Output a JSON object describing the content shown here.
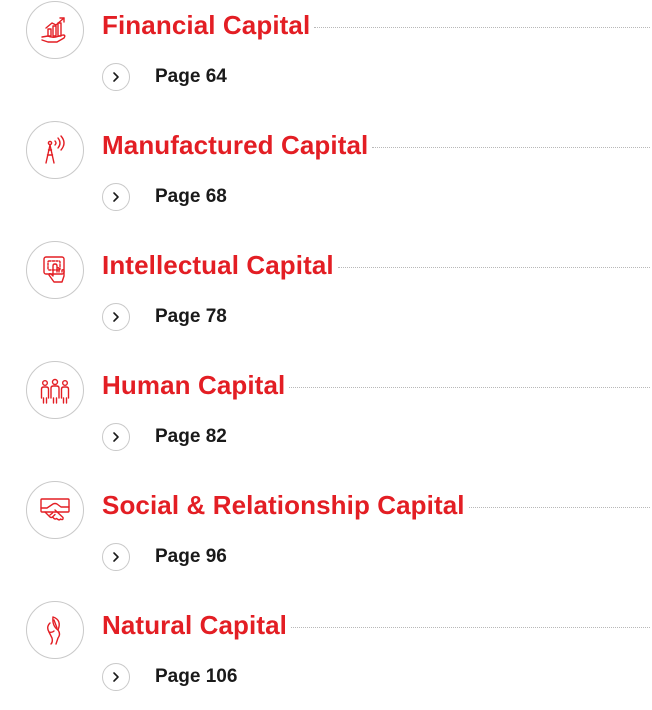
{
  "colors": {
    "accent": "#e31e24",
    "text": "#1a1a1a",
    "ring": "#c9c9c9"
  },
  "capitals": [
    {
      "title": "Financial Capital",
      "page": "Page 64",
      "icon": "financial-growth-icon"
    },
    {
      "title": "Manufactured Capital",
      "page": "Page 68",
      "icon": "transmission-tower-icon"
    },
    {
      "title": "Intellectual Capital",
      "page": "Page 78",
      "icon": "touchscreen-hand-icon"
    },
    {
      "title": "Human Capital",
      "page": "Page 82",
      "icon": "people-group-icon"
    },
    {
      "title": "Social & Relationship Capital",
      "page": "Page 96",
      "icon": "handshake-icon"
    },
    {
      "title": "Natural Capital",
      "page": "Page 106",
      "icon": "leaf-hand-icon"
    }
  ]
}
